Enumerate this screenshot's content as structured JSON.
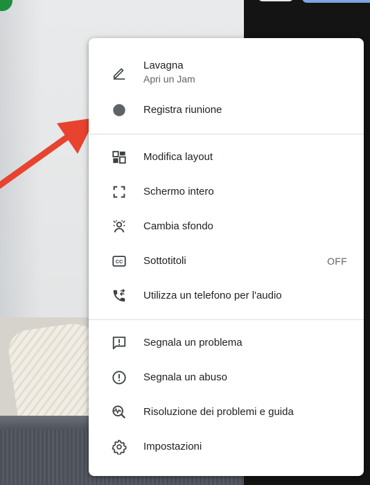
{
  "colors": {
    "accent_arrow": "#e8432f",
    "menu_bg": "#ffffff",
    "text_primary": "#202124",
    "text_secondary": "#5f6368",
    "divider": "#dadce0",
    "icon": "#3c4043"
  },
  "menu": {
    "groups": [
      {
        "items": [
          {
            "id": "whiteboard",
            "label": "Lavagna",
            "sublabel": "Apri un Jam",
            "icon": "pencil-icon"
          },
          {
            "id": "record",
            "label": "Registra riunione",
            "icon": "record-dot-icon"
          }
        ]
      },
      {
        "items": [
          {
            "id": "layout",
            "label": "Modifica layout",
            "icon": "layout-icon"
          },
          {
            "id": "fullscreen",
            "label": "Schermo intero",
            "icon": "fullscreen-icon"
          },
          {
            "id": "background",
            "label": "Cambia sfondo",
            "icon": "background-blur-icon"
          },
          {
            "id": "captions",
            "label": "Sottotitoli",
            "icon": "closed-captions-icon",
            "state": "OFF"
          },
          {
            "id": "phone-audio",
            "label": "Utilizza un telefono per l'audio",
            "icon": "phone-forward-icon"
          }
        ]
      },
      {
        "items": [
          {
            "id": "report-problem",
            "label": "Segnala un problema",
            "icon": "feedback-icon"
          },
          {
            "id": "report-abuse",
            "label": "Segnala un abuso",
            "icon": "alert-circle-icon"
          },
          {
            "id": "troubleshooting",
            "label": "Risoluzione dei problemi e guida",
            "icon": "troubleshoot-icon"
          },
          {
            "id": "settings",
            "label": "Impostazioni",
            "icon": "gear-icon"
          }
        ]
      }
    ]
  }
}
